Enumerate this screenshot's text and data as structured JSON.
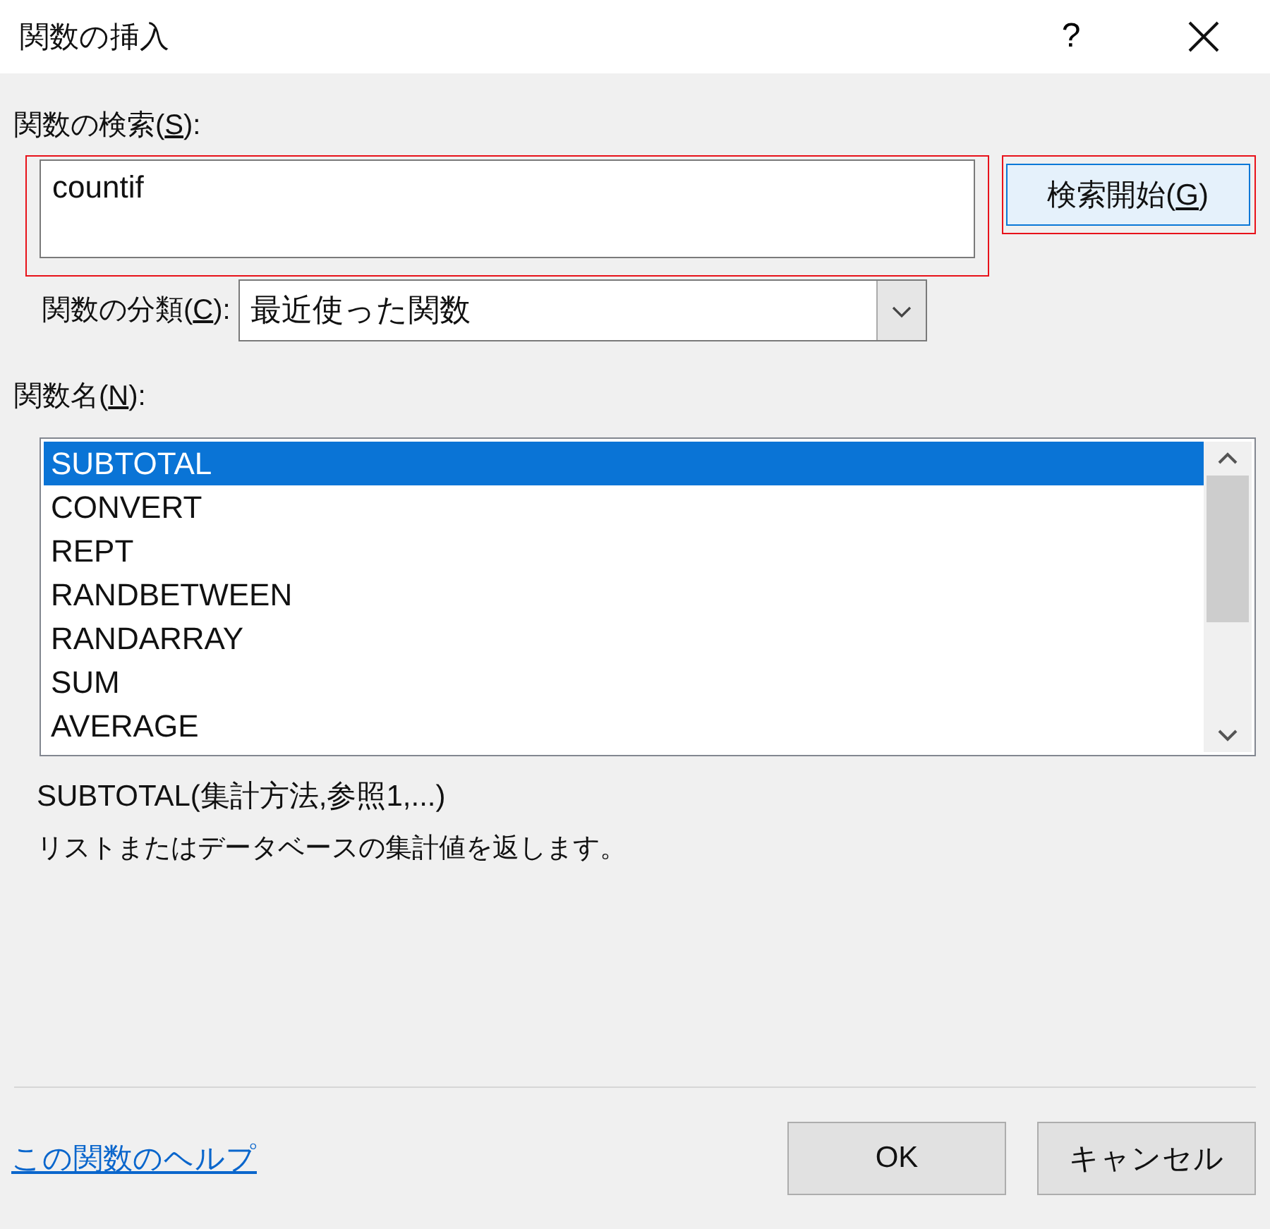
{
  "window": {
    "title": "関数の挿入",
    "help_button": "?"
  },
  "search": {
    "label": {
      "before": "関数の検索(",
      "key": "S",
      "after": "):"
    },
    "value": "countif",
    "highlighted": true
  },
  "search_button": {
    "before": "検索開始(",
    "key": "G",
    "after": ")",
    "highlighted": true
  },
  "category": {
    "label": {
      "before": "関数の分類(",
      "key": "C",
      "after": "):"
    },
    "value": "最近使った関数"
  },
  "function_list": {
    "label": {
      "before": "関数名(",
      "key": "N",
      "after": "):"
    },
    "items": [
      {
        "name": "SUBTOTAL",
        "selected": true
      },
      {
        "name": "CONVERT",
        "selected": false
      },
      {
        "name": "REPT",
        "selected": false
      },
      {
        "name": "RANDBETWEEN",
        "selected": false
      },
      {
        "name": "RANDARRAY",
        "selected": false
      },
      {
        "name": "SUM",
        "selected": false
      },
      {
        "name": "AVERAGE",
        "selected": false
      }
    ]
  },
  "syntax": "SUBTOTAL(集計方法,参照1,...)",
  "description": "リストまたはデータベースの集計値を返します。",
  "help_link": "この関数のヘルプ",
  "buttons": [
    {
      "label": "OK",
      "kind": "ok"
    },
    {
      "label": "キャンセル",
      "kind": "cancel"
    }
  ]
}
